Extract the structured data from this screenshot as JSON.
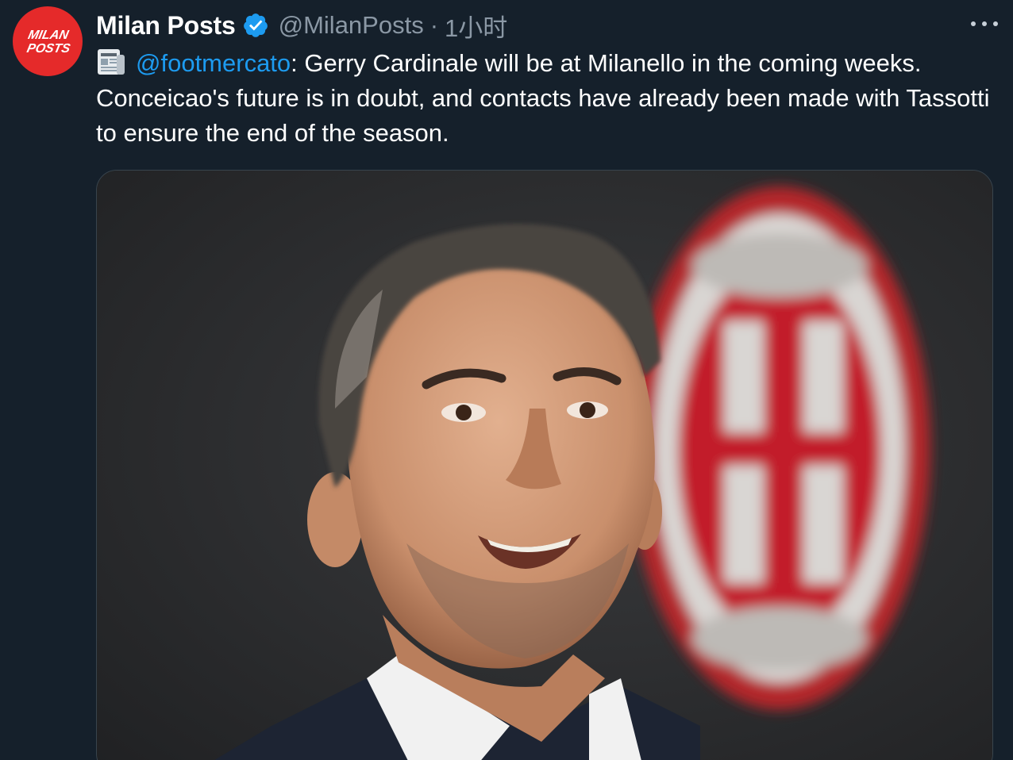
{
  "account": {
    "display_name": "Milan Posts",
    "handle": "@MilanPosts",
    "separator": "·",
    "time_ago": "1小时",
    "avatar_text_line1": "MILAN",
    "avatar_text_line2": "POSTS",
    "verified_icon": "verified-badge-icon"
  },
  "tweet": {
    "prefix_icon": "newspaper-icon",
    "mention": "@footmercato",
    "text": ": Gerry Cardinale will be at Milanello in the coming weeks. Conceicao's future is in doubt, and contacts have already been made with Tassotti to ensure the end of the season."
  },
  "media": {
    "description_icon": "photo-man-smiling-ac-milan-crest"
  },
  "menu": {
    "more_icon": "more-horizontal-icon"
  },
  "colors": {
    "background": "#15202b",
    "accent": "#1d9bf0",
    "muted": "#8b98a5",
    "avatar": "#e52a2a",
    "milan_red": "#c0202a"
  }
}
